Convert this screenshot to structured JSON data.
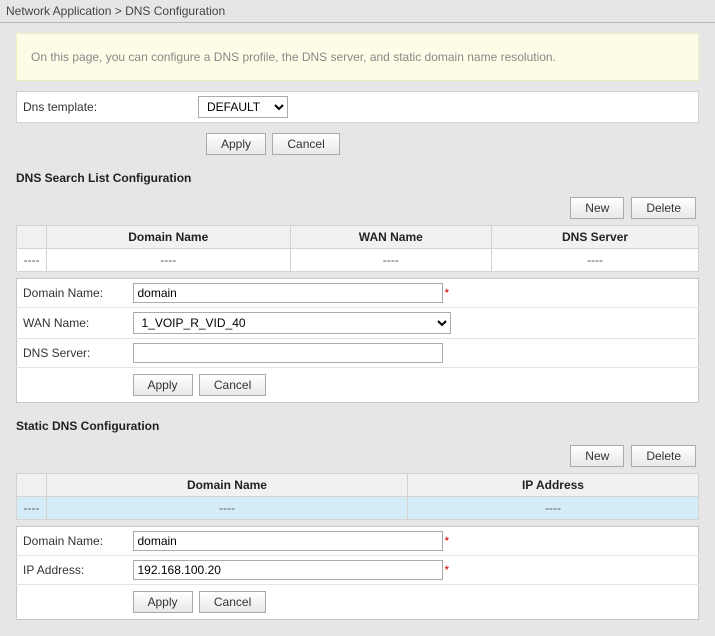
{
  "breadcrumb": "Network Application > DNS Configuration",
  "info_text": "On this page, you can configure a DNS profile, the DNS server, and static domain name resolution.",
  "dns_template": {
    "label": "Dns template:",
    "value": "DEFAULT",
    "apply": "Apply",
    "cancel": "Cancel"
  },
  "search_list": {
    "title": "DNS Search List Configuration",
    "new_btn": "New",
    "delete_btn": "Delete",
    "columns": {
      "c1": "Domain Name",
      "c2": "WAN Name",
      "c3": "DNS Server"
    },
    "placeholder": "----",
    "form": {
      "domain_label": "Domain Name:",
      "domain_value": "domain",
      "wan_label": "WAN Name:",
      "wan_value": "1_VOIP_R_VID_40",
      "dns_label": "DNS Server:",
      "dns_value": "",
      "apply": "Apply",
      "cancel": "Cancel"
    }
  },
  "static_dns": {
    "title": "Static DNS Configuration",
    "new_btn": "New",
    "delete_btn": "Delete",
    "columns": {
      "c1": "Domain Name",
      "c2": "IP Address"
    },
    "placeholder": "----",
    "form": {
      "domain_label": "Domain Name:",
      "domain_value": "domain",
      "ip_label": "IP Address:",
      "ip_value": "192.168.100.20",
      "apply": "Apply",
      "cancel": "Cancel"
    }
  }
}
